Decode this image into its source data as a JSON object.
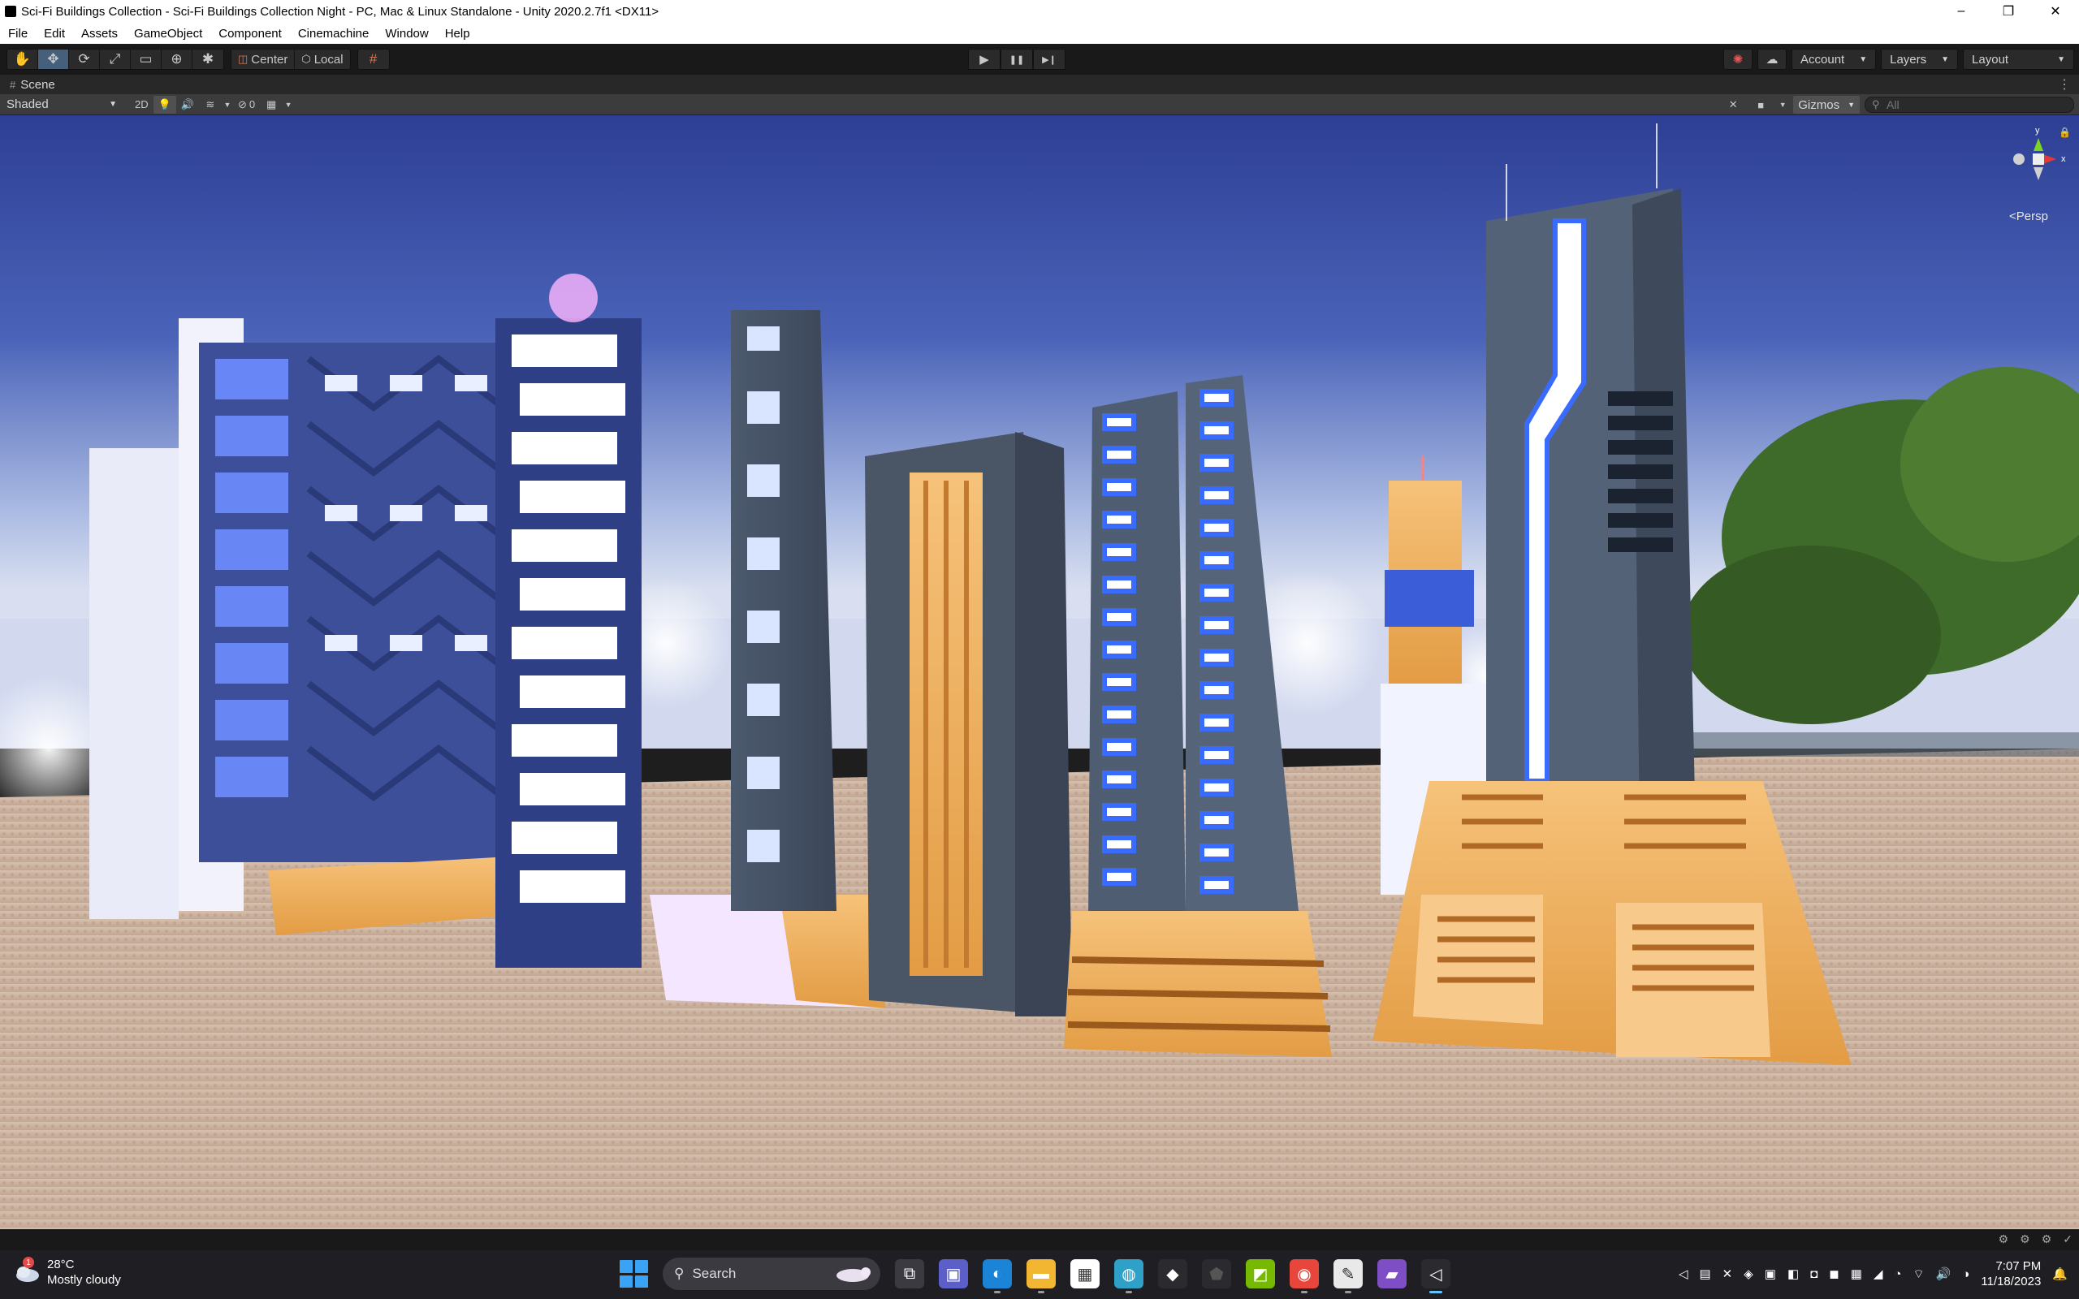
{
  "window": {
    "title": "Sci-Fi Buildings Collection - Sci-Fi Buildings Collection Night - PC, Mac & Linux Standalone - Unity 2020.2.7f1 <DX11>",
    "minimize": "–",
    "maximize": "❐",
    "close": "✕"
  },
  "menu": [
    "File",
    "Edit",
    "Assets",
    "GameObject",
    "Component",
    "Cinemachine",
    "Window",
    "Help"
  ],
  "toolbar": {
    "tools": [
      {
        "icon": "hand-icon",
        "glyph": "✋"
      },
      {
        "icon": "move-icon",
        "glyph": "✥"
      },
      {
        "icon": "rotate-icon",
        "glyph": "⟳"
      },
      {
        "icon": "scale-icon",
        "glyph": "⤢"
      },
      {
        "icon": "rect-icon",
        "glyph": "▭"
      },
      {
        "icon": "transform-icon",
        "glyph": "⊕"
      },
      {
        "icon": "custom-tool-icon",
        "glyph": "✱"
      }
    ],
    "pivot_label": "Center",
    "pivot_space_label": "Local",
    "snap_glyph": "#",
    "play_glyph": "▶",
    "pause_glyph": "❚❚",
    "step_glyph": "▶❙",
    "collab_glyph": "✺",
    "cloud_glyph": "☁",
    "account_label": "Account",
    "layers_label": "Layers",
    "layout_label": "Layout",
    "dropdown_arrow": "▼"
  },
  "scene": {
    "tab_label": "Scene",
    "tab_hash": "#",
    "tab_menu": "⋮",
    "shading_mode": "Shaded",
    "mode_2d": "2D",
    "light_glyph": "💡",
    "audio_glyph": "🔊",
    "effects_glyph": "≋",
    "hidden_glyph": "⊘",
    "hidden_count": "0",
    "grid_glyph": "▦",
    "tools_glyph": "✕",
    "camera_glyph": "■",
    "gizmos_label": "Gizmos",
    "search_placeholder": "All",
    "search_glyph": "⚲",
    "persp_label": "<Persp",
    "lock_glyph": "🔒",
    "axis_y": "y",
    "axis_x": "x"
  },
  "status_icons": [
    "⚙",
    "⚙",
    "⚙",
    "✓"
  ],
  "taskbar": {
    "weather_temp": "28°C",
    "weather_desc": "Mostly cloudy",
    "weather_badge": "1",
    "search_label": "Search",
    "search_glyph": "⚲",
    "apps": [
      {
        "name": "task-view-icon",
        "glyph": "⧉",
        "bg": "#3a3a40"
      },
      {
        "name": "meet-icon",
        "glyph": "▣",
        "bg": "#5b5fc7"
      },
      {
        "name": "edge-icon",
        "glyph": "◐",
        "bg": "#1c84d6"
      },
      {
        "name": "file-explorer-icon",
        "glyph": "▬",
        "bg": "#f2b632"
      },
      {
        "name": "store-icon",
        "glyph": "▦",
        "bg": "#ffffff"
      },
      {
        "name": "globe-icon",
        "glyph": "◍",
        "bg": "#2fa0c8"
      },
      {
        "name": "alienware-icon",
        "glyph": "◆",
        "bg": "#2b2b2f"
      },
      {
        "name": "shield-app-icon",
        "glyph": "⬟",
        "bg": "#2b2b2f"
      },
      {
        "name": "nvidia-icon",
        "glyph": "◩",
        "bg": "#76b900"
      },
      {
        "name": "chrome-icon",
        "glyph": "◉",
        "bg": "#e8453c"
      },
      {
        "name": "notepad-icon",
        "glyph": "✎",
        "bg": "#e9e9e9"
      },
      {
        "name": "clapper-icon",
        "glyph": "▰",
        "bg": "#7e4fc4"
      },
      {
        "name": "unity-icon",
        "glyph": "◁",
        "bg": "#2b2b2f"
      }
    ],
    "tray": [
      "◁",
      "▤",
      "✕",
      "◈",
      "▣",
      "◧",
      "◘",
      "◼",
      "▦",
      "◢",
      "◔",
      "⌔",
      "🔊",
      "◑"
    ],
    "time": "7:07 PM",
    "date": "11/18/2023",
    "bell_glyph": "🔔"
  },
  "colors": {
    "editor_dark": "#191919",
    "scene_ctrl": "#3c3c3c",
    "active_tool": "#46607c",
    "sky_top": "#3a4fa8",
    "sky_bottom": "#b7c6e6",
    "ground": "#c9ae9a",
    "neon_blue": "#3a6bff",
    "neon_orange": "#f1a84a"
  }
}
